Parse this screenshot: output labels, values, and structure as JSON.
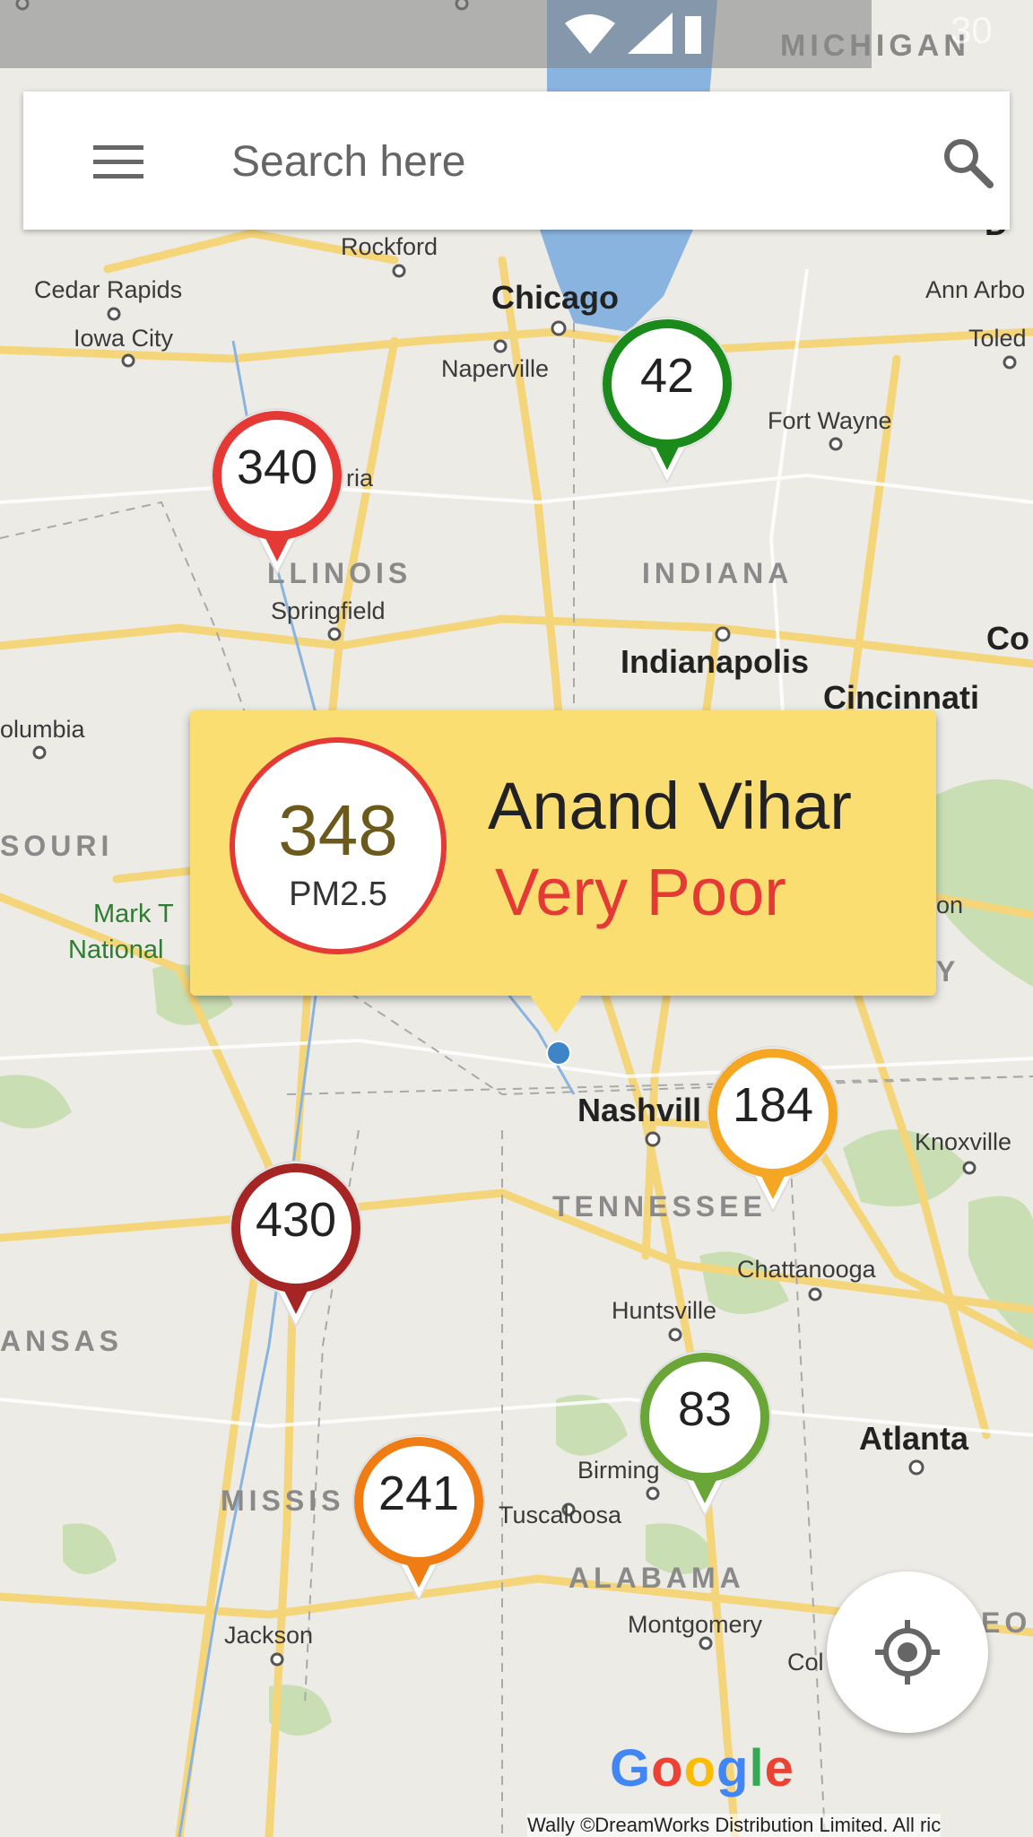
{
  "status_bar": {
    "icons": [
      "wifi-icon",
      "signal-icon",
      "battery-icon"
    ],
    "time_partial": "30"
  },
  "search": {
    "placeholder": "Search here"
  },
  "map_labels": {
    "cities": [
      "Rockford",
      "Cedar Rapids",
      "Iowa City",
      "Chicago",
      "Naperville",
      "Ann Arbo",
      "Toled",
      "Fort Wayne",
      "ria",
      "Springfield",
      "Indianapolis",
      "Cincinnati",
      "Co",
      "olumbia",
      "Nashvill",
      "Knoxville",
      "Chattanooga",
      "Huntsville",
      "Birming",
      "Tuscaloosa",
      "Atlanta",
      "Montgomery",
      "Col",
      "Jackson",
      "on",
      "D"
    ],
    "states": [
      "MICHIGAN",
      "LLINOIS",
      "INDIANA",
      "SOURI",
      "TENNESSEE",
      "ANSAS",
      "MISSIS",
      "ALABAMA",
      "EO",
      "Y"
    ],
    "parks": [
      "Mark T",
      "National"
    ]
  },
  "markers": [
    {
      "value": "340",
      "color": "#e53935"
    },
    {
      "value": "42",
      "color": "#1a8a1a"
    },
    {
      "value": "184",
      "color": "#f5a623"
    },
    {
      "value": "430",
      "color": "#a52424"
    },
    {
      "value": "83",
      "color": "#6aa637"
    },
    {
      "value": "241",
      "color": "#ef7d14"
    }
  ],
  "info_window": {
    "aqi_value": "348",
    "aqi_unit": "PM2.5",
    "station_name": "Anand Vihar",
    "category": "Very Poor",
    "category_color": "#e53935",
    "background_color": "#fbde72"
  },
  "controls": {
    "my_location_icon": "crosshair-icon"
  },
  "branding": {
    "google_logo": "Google",
    "attribution": "Wally ©DreamWorks Distribution Limited. All ric"
  }
}
